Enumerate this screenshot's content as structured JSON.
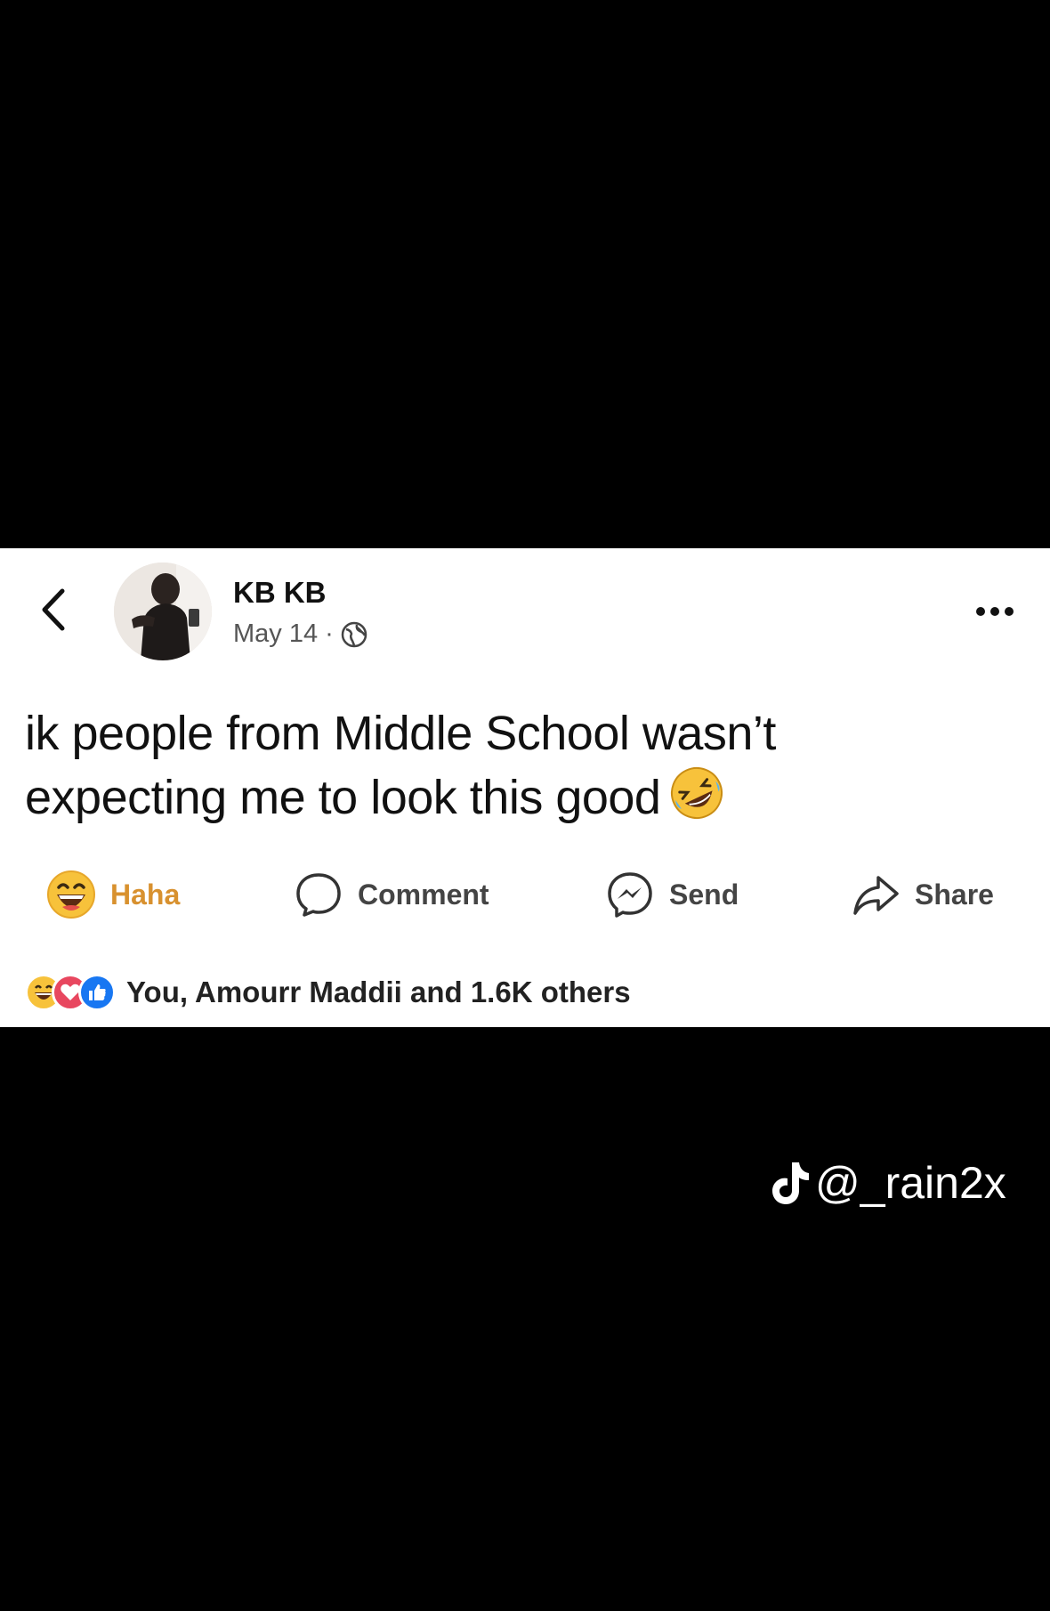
{
  "post": {
    "author": "KB KB",
    "date": "May 14",
    "separator": "·",
    "privacy_icon": "globe-icon",
    "text_line1": "ik people from Middle School wasn’t",
    "text_line2": "expecting me to look this good",
    "text_emoji": "rolling-on-floor-laughing-icon"
  },
  "actions": {
    "haha": "Haha",
    "comment": "Comment",
    "send": "Send",
    "share": "Share"
  },
  "reactions": {
    "summary": "You, Amourr Maddii and 1.6K others",
    "icons": [
      "haha-icon",
      "love-icon",
      "like-icon"
    ]
  },
  "watermark": {
    "handle": "@_rain2x",
    "icon": "tiktok-icon"
  },
  "colors": {
    "background": "#000000",
    "card": "#ffffff",
    "haha": "#f7c23b",
    "love": "#e8475f",
    "like": "#1877f2"
  }
}
